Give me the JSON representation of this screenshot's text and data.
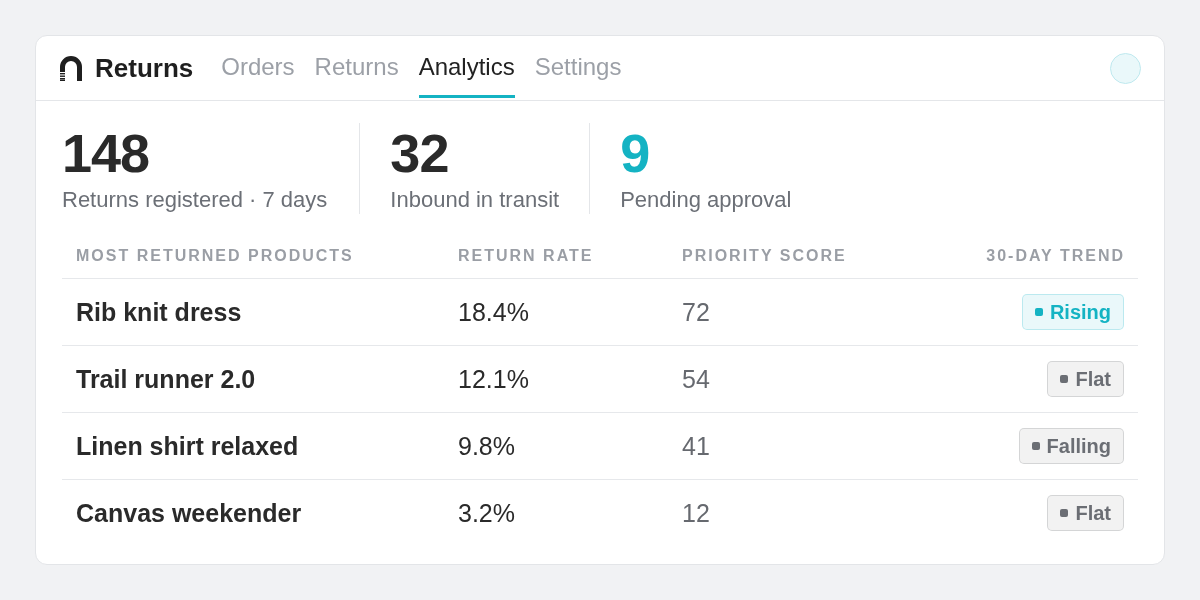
{
  "brand": {
    "name": "Returns"
  },
  "tabs": [
    {
      "label": "Orders",
      "selected": false
    },
    {
      "label": "Returns",
      "selected": false
    },
    {
      "label": "Analytics",
      "selected": true
    },
    {
      "label": "Settings",
      "selected": false
    }
  ],
  "stats": [
    {
      "value": "148",
      "label": "Returns registered · 7 days",
      "color": "#2a2a2a"
    },
    {
      "value": "32",
      "label": "Inbound in transit",
      "color": "#2a2a2a"
    },
    {
      "value": "9",
      "label": "Pending approval",
      "color": "#14b3c3"
    }
  ],
  "table": {
    "columns": [
      "MOST RETURNED PRODUCTS",
      "RETURN RATE",
      "PRIORITY SCORE",
      "30-DAY TREND"
    ],
    "rows": [
      {
        "product": "Rib knit dress",
        "return_rate": "18.4%",
        "priority_score": "72",
        "trend": {
          "label": "Rising",
          "color": "#14b3c3"
        }
      },
      {
        "product": "Trail runner 2.0",
        "return_rate": "12.1%",
        "priority_score": "54",
        "trend": {
          "label": "Flat",
          "color": "#6b6e74"
        }
      },
      {
        "product": "Linen shirt relaxed",
        "return_rate": "9.8%",
        "priority_score": "41",
        "trend": {
          "label": "Falling",
          "color": "#6b6e74"
        }
      },
      {
        "product": "Canvas weekender",
        "return_rate": "3.2%",
        "priority_score": "12",
        "trend": {
          "label": "Flat",
          "color": "#6b6e74"
        }
      }
    ]
  }
}
